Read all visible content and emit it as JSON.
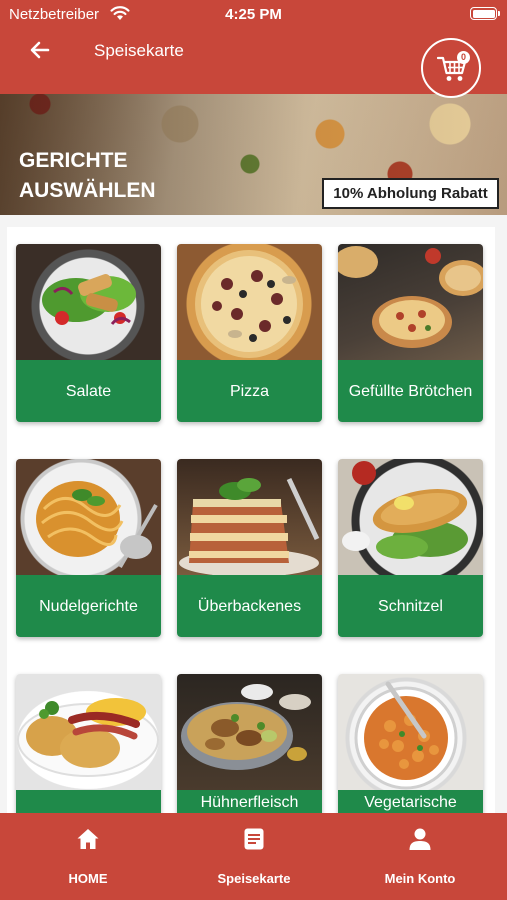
{
  "status_bar": {
    "carrier": "Netzbetreiber",
    "time": "4:25 PM"
  },
  "header": {
    "title": "Speisekarte",
    "cart_count": "0"
  },
  "banner": {
    "title": "GERICHTE AUSWÄHLEN",
    "discount": "10% Abholung Rabatt"
  },
  "categories": [
    {
      "label": "Salate"
    },
    {
      "label": "Pizza"
    },
    {
      "label": "Gefüllte Brötchen"
    },
    {
      "label": "Nudelgerichte"
    },
    {
      "label": "Überbackenes"
    },
    {
      "label": "Schnitzel"
    },
    {
      "label": ""
    },
    {
      "label": "Hühnerfleisch"
    },
    {
      "label": "Vegetarische"
    }
  ],
  "bottom_nav": [
    {
      "label": "HOME",
      "icon": "home-icon"
    },
    {
      "label": "Speisekarte",
      "icon": "menu-book-icon"
    },
    {
      "label": "Mein Konto",
      "icon": "user-icon"
    }
  ],
  "colors": {
    "primary": "#c8473a",
    "category": "#1f8a4a",
    "background": "#f4f4f4"
  }
}
